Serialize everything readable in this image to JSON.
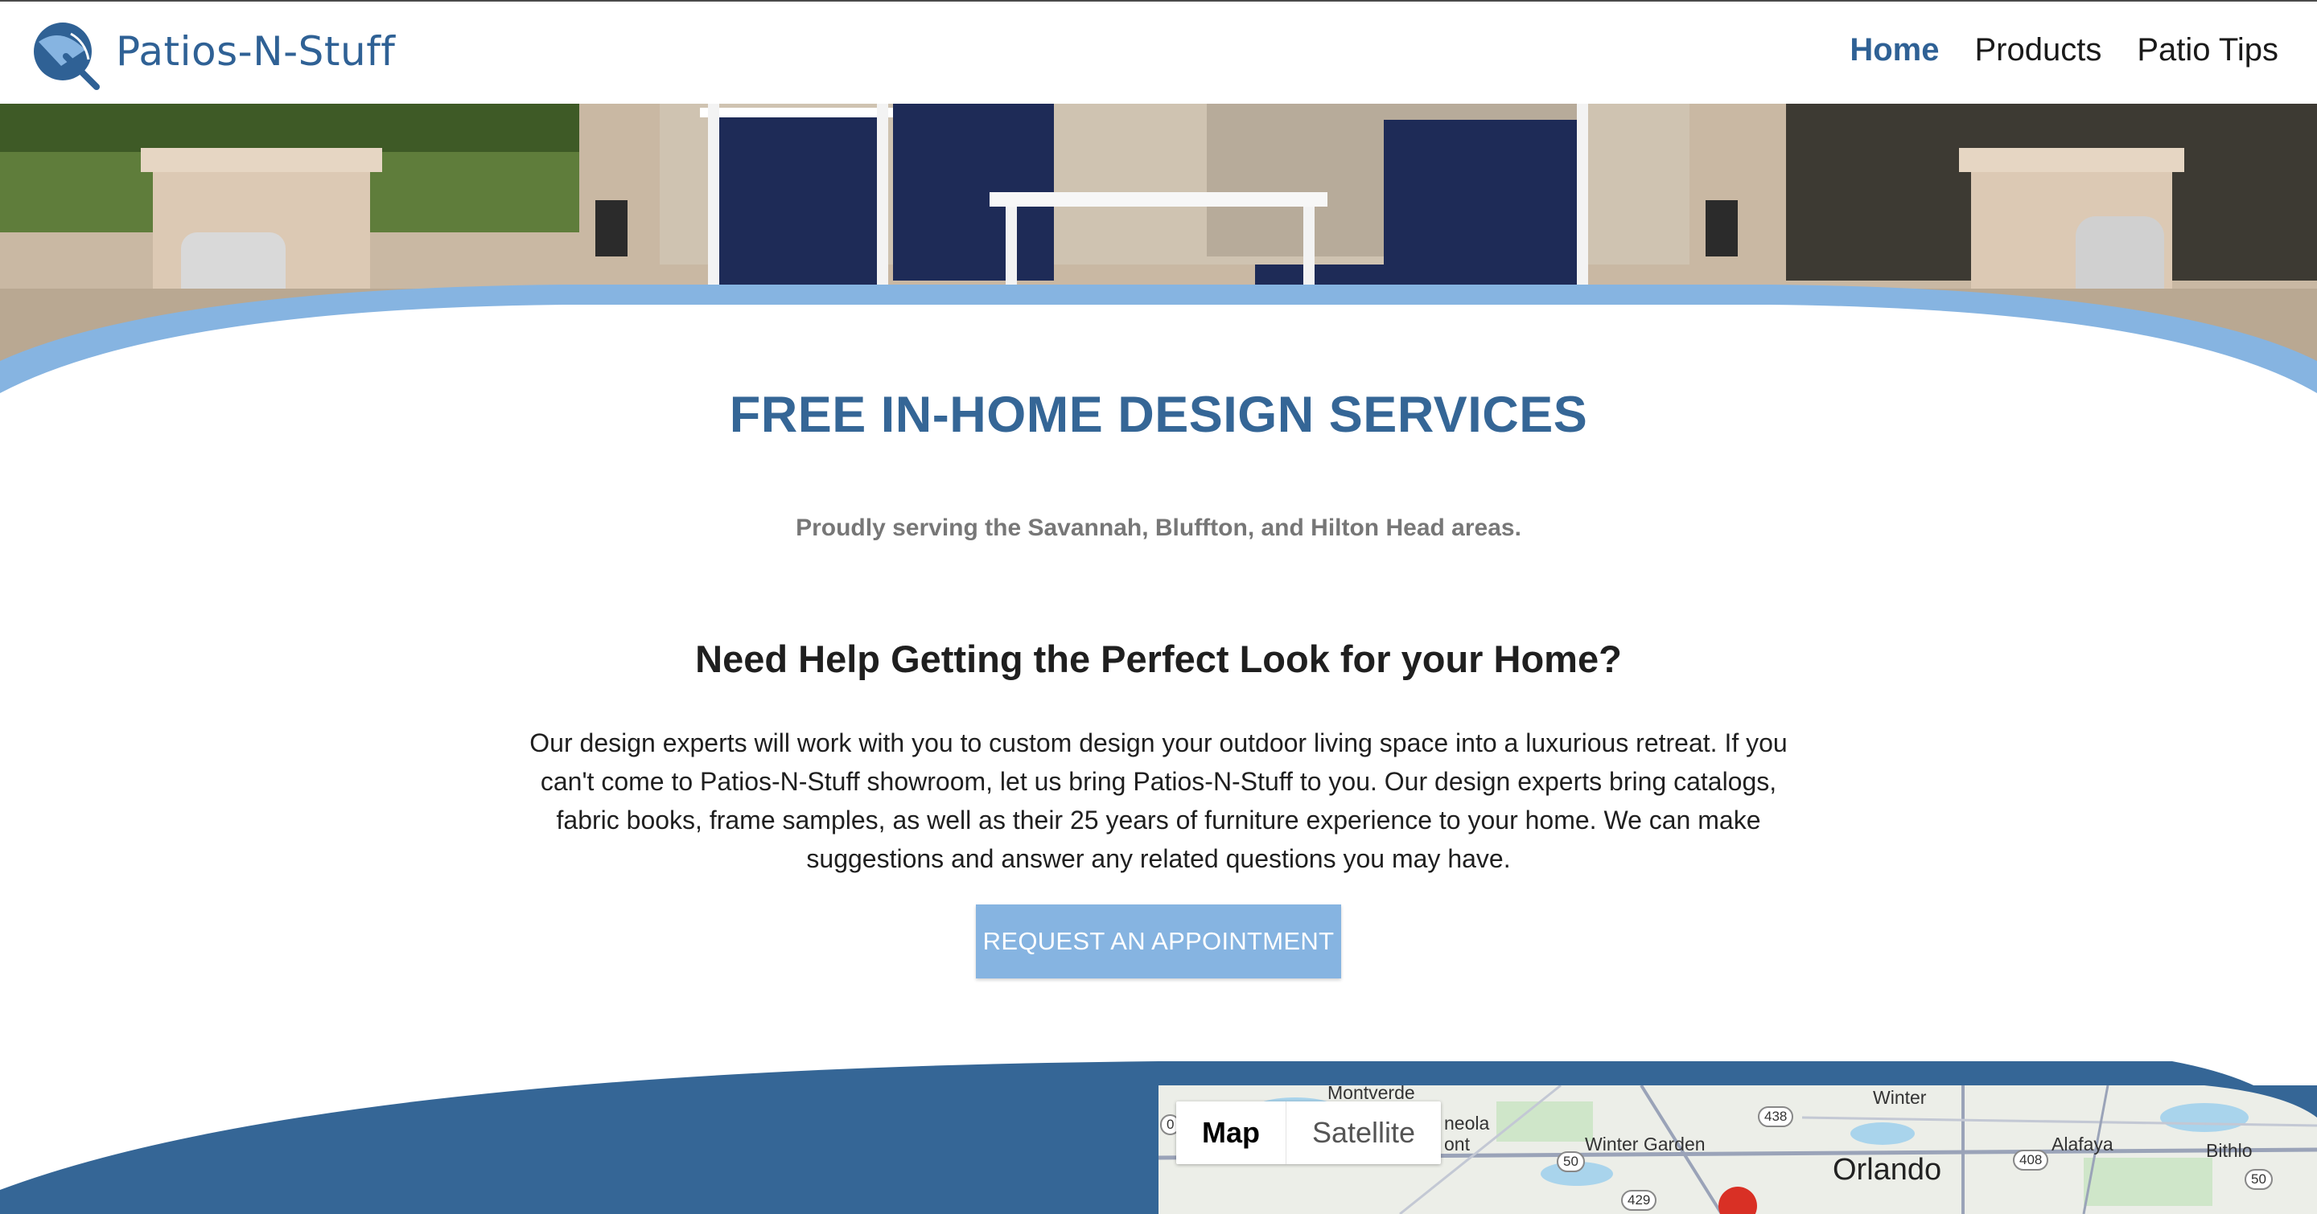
{
  "brand": {
    "name": "Patios-N-Stuff",
    "logo_icon": "umbrella-logo-icon"
  },
  "nav": {
    "items": [
      {
        "label": "Home",
        "active": true
      },
      {
        "label": "Products",
        "active": false
      },
      {
        "label": "Patio Tips",
        "active": false
      }
    ]
  },
  "hero": {
    "image": "patio-furniture-photo"
  },
  "main": {
    "title": "FREE IN-HOME DESIGN SERVICES",
    "subtitle": "Proudly serving the Savannah, Bluffton, and Hilton Head areas.",
    "help_title": "Need Help Getting the Perfect Look for your Home?",
    "body": "Our design experts will work with you to custom design your outdoor living space into a luxurious retreat. If you can't come to Patios-N-Stuff showroom, let us bring Patios-N-Stuff to you. Our design experts bring catalogs, fabric books, frame samples, as well as their 25 years of furniture experience to your home. We can make suggestions and answer any related questions you may have.",
    "cta_label": "REQUEST AN APPOINTMENT"
  },
  "map": {
    "toggle": {
      "map_label": "Map",
      "satellite_label": "Satellite",
      "selected": "Map"
    },
    "places": [
      "Montverde",
      "Winter",
      "Winter Garden",
      "Orlando",
      "Alafaya",
      "Bithlo",
      "neola",
      "ont"
    ],
    "route_shields": [
      "438",
      "50",
      "408",
      "429",
      "50",
      "0"
    ]
  },
  "colors": {
    "primary": "#356696",
    "accent": "#86b4e1",
    "band": "#356696",
    "nav_active": "#2f6195"
  }
}
